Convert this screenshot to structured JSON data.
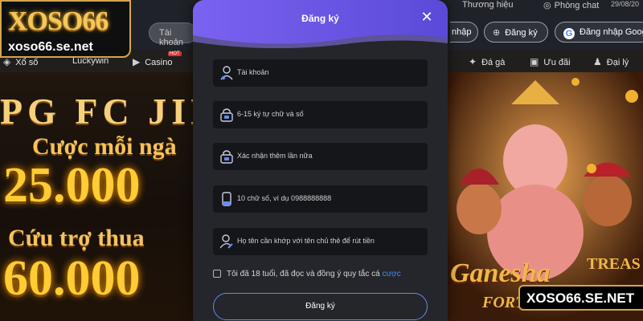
{
  "brand": {
    "logo_text": "XOSO66",
    "logo_url_text": "xoso66.se.net",
    "watermark": "XOSO66.SE.NET"
  },
  "header": {
    "search_placeholder": "Tài khoản",
    "top_links": [
      "Thương hiệu",
      "Phòng chat"
    ],
    "date_partial": "29/08/20",
    "login_label": "nhập",
    "register_label": "Đăng ký",
    "google_login_label": "Đăng nhập Google"
  },
  "nav": {
    "items": [
      "Xổ số",
      "Luckywin",
      "Casino",
      "Đá gà",
      "Ưu đãi",
      "Đại lý"
    ],
    "hot_badge": "HOT"
  },
  "banner": {
    "providers": "PG FC JILI",
    "line1": "Cược mỗi ngà",
    "amount1": "25.000",
    "line2": "Cứu trợ thua",
    "amount2": "60.000",
    "game_title": "Ganesha",
    "game_title_2": "TREAS",
    "game_title_3": "FORT"
  },
  "modal": {
    "title": "Đăng ký",
    "fields": [
      {
        "icon": "user-icon",
        "placeholder": "Tài khoản"
      },
      {
        "icon": "lock-icon",
        "placeholder": "6-15 ký tự chữ và số"
      },
      {
        "icon": "lock-icon",
        "placeholder": "Xác nhận thêm lần nữa"
      },
      {
        "icon": "phone-icon",
        "placeholder": "10 chữ số, ví dụ 0988888888"
      },
      {
        "icon": "user-edit-icon",
        "placeholder": "Họ tên cần khớp với tên chủ thẻ để rút tiền"
      }
    ],
    "terms_text": "Tôi đã 18 tuổi, đã đọc và đồng ý quy tắc cá ",
    "terms_link": "cược",
    "submit_label": "Đăng ký"
  },
  "colors": {
    "accent_purple": "#6d5ae6",
    "link_blue": "#4b8cf0",
    "gold": "#f3c85a"
  }
}
